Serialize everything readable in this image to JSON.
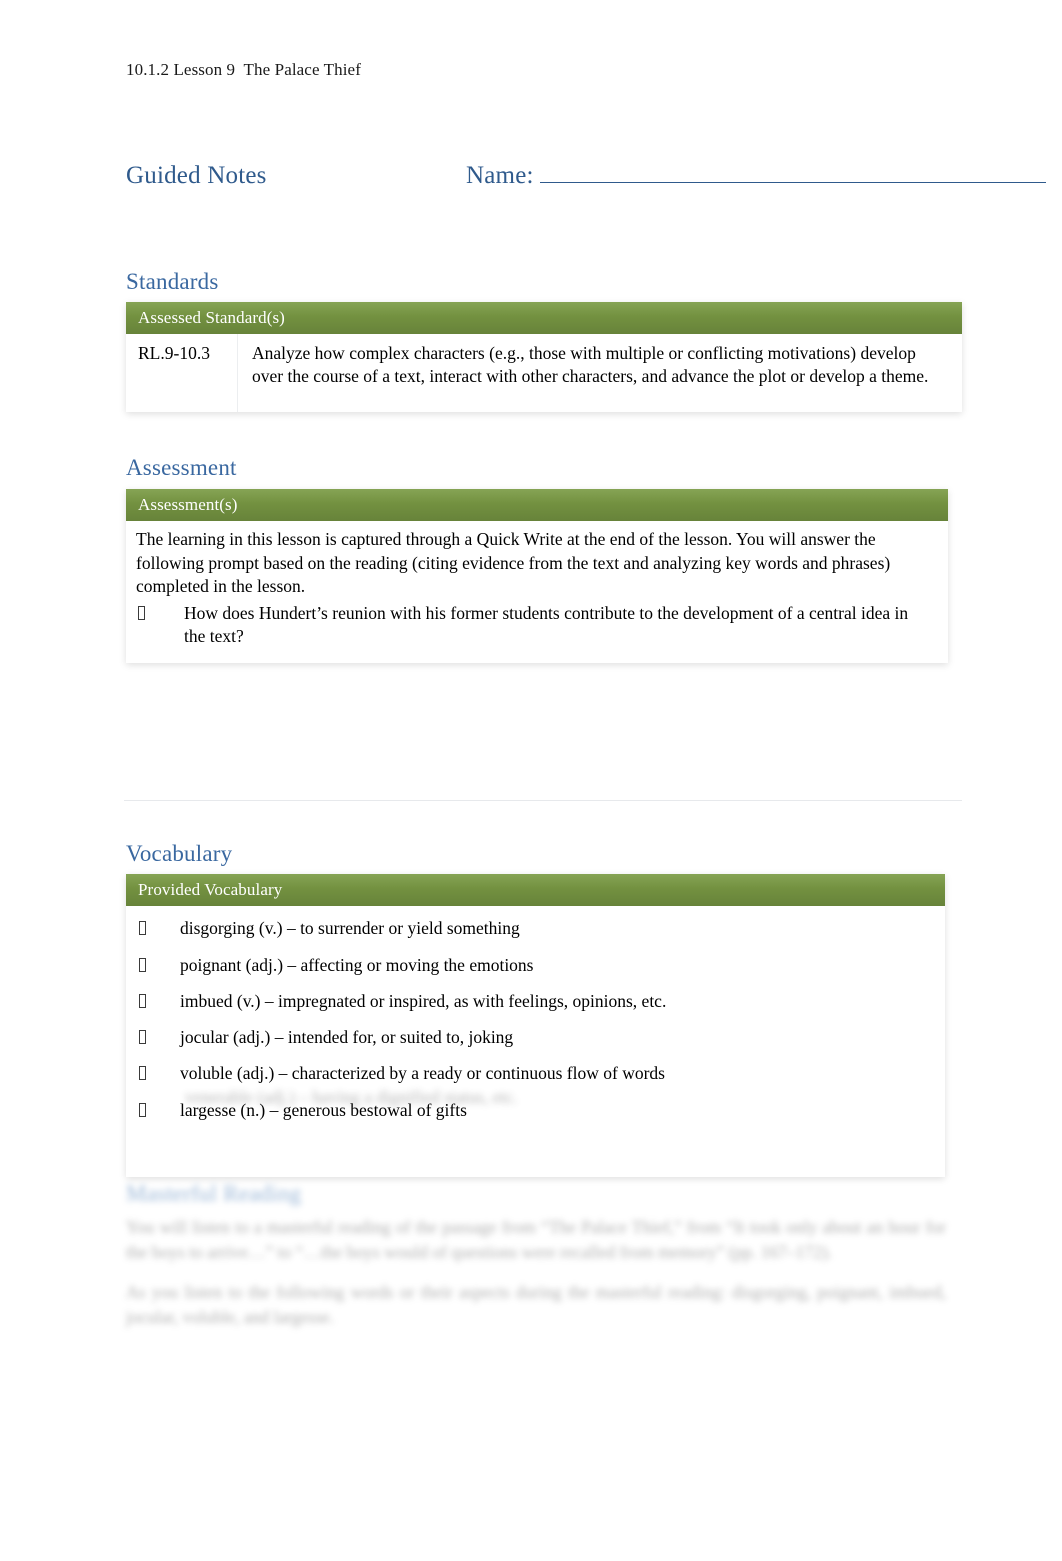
{
  "document": {
    "running_header": "10.1.2 Lesson 9  The Palace Thief",
    "title": "Guided Notes",
    "name_label": "Name:"
  },
  "standards": {
    "heading": "Standards",
    "table_header": "Assessed Standard(s)",
    "rows": [
      {
        "code": "RL.9-10.3",
        "text": "Analyze how complex characters (e.g., those with multiple or conflicting motivations) develop over the course of a text, interact with other characters, and advance the plot or develop a theme."
      }
    ]
  },
  "assessment": {
    "heading": "Assessment",
    "table_header": "Assessment(s)",
    "paragraph": "The learning in this lesson is captured through a Quick Write at the end of the lesson. You will answer the following prompt based on the reading (citing evidence from the text and analyzing key words and phrases) completed in the lesson.",
    "bullets": [
      "How does Hundert’s reunion with his former students contribute to the development of a central idea in the text?"
    ]
  },
  "vocabulary": {
    "heading": "Vocabulary",
    "table_header": "Provided Vocabulary",
    "items": [
      "disgorging (v.) – to surrender or yield something",
      "poignant (adj.) – affecting or moving the emotions",
      "imbued (v.) – impregnated or inspired, as with feelings, opinions, etc.",
      " jocular (adj.) – intended for, or suited to, joking",
      "voluble (adj.) – characterized by a ready or continuous flow of words",
      "largesse (n.) – generous bestowal of gifts"
    ],
    "faded_item": "venerable (adj.) – having a dignified status, etc."
  },
  "masterful_reading": {
    "heading": "Masterful Reading",
    "paragraph_1": "You will listen to a masterful reading of the passage from “The Palace Thief,” from “It took only about an hour for the boys to arrive…” to “…the boys would of questions were recalled from memory” (pp. 167–172).",
    "paragraph_2": "As you listen to the following words or their aspects during the masterful reading: disgorging, poignant, imbued, jocular, voluble, and largesse."
  },
  "colors": {
    "heading_blue": "#3a68a0",
    "title_blue": "#2f5a8c",
    "table_header_green": "#739140",
    "body_text": "#000000"
  }
}
